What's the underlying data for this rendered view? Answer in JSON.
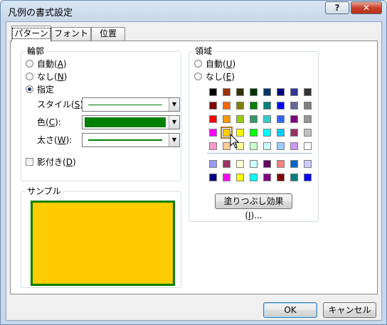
{
  "window": {
    "title": "凡例の書式設定",
    "help_icon": "question-mark",
    "close_icon": "x-mark"
  },
  "tabs": [
    {
      "label": "パターン",
      "active": true
    },
    {
      "label": "フォント",
      "active": false
    },
    {
      "label": "位置",
      "active": false
    }
  ],
  "border": {
    "label": "輪郭",
    "auto": {
      "text": "自動(",
      "key": "A",
      "end": ")"
    },
    "none": {
      "text": "なし(",
      "key": "N",
      "end": ")"
    },
    "custom": {
      "text": "指定"
    },
    "selected": "custom",
    "style": {
      "text": "スタイル(",
      "key": "S",
      "end": "):",
      "line_color": "#008000"
    },
    "color": {
      "text": "色(",
      "key": "C",
      "end": "):",
      "value": "#008000"
    },
    "weight": {
      "text": "太さ(",
      "key": "W",
      "end": "):",
      "line_color": "#008000"
    },
    "shadow": {
      "text": "影付き(",
      "key": "D",
      "end": ")",
      "checked": false
    }
  },
  "area": {
    "label": "領域",
    "auto": {
      "text": "自動(",
      "key": "U",
      "end": ")"
    },
    "none": {
      "text": "なし(",
      "key": "E",
      "end": ")"
    },
    "selected_color": "#ffcc00",
    "palette_main": [
      [
        "#000000",
        "#993300",
        "#333300",
        "#003300",
        "#003366",
        "#000080",
        "#333399",
        "#333333"
      ],
      [
        "#800000",
        "#ff6600",
        "#808000",
        "#008000",
        "#008080",
        "#0000ff",
        "#666699",
        "#808080"
      ],
      [
        "#ff0000",
        "#ff9900",
        "#99cc00",
        "#339966",
        "#33cccc",
        "#3366ff",
        "#800080",
        "#969696"
      ],
      [
        "#ff00ff",
        "#ffcc00",
        "#ffff00",
        "#00ff00",
        "#00ffff",
        "#00ccff",
        "#993366",
        "#c0c0c0"
      ],
      [
        "#ff99cc",
        "#ffcc99",
        "#ffff99",
        "#ccffcc",
        "#ccffff",
        "#99ccff",
        "#cc99ff",
        "#ffffff"
      ]
    ],
    "palette_extra": [
      [
        "#9999ff",
        "#993366",
        "#ffffcc",
        "#ccffff",
        "#660066",
        "#ff8080",
        "#0066cc",
        "#ccccff"
      ],
      [
        "#000080",
        "#ff00ff",
        "#ffff00",
        "#00ffff",
        "#800080",
        "#800000",
        "#008080",
        "#0000ff"
      ]
    ],
    "fill_effects": {
      "text": "塗りつぶし効果(",
      "key": "I",
      "end": ")..."
    }
  },
  "sample": {
    "label": "サンプル",
    "fill": "#ffcc00",
    "border": "#008000"
  },
  "buttons": {
    "ok": "OK",
    "cancel": "キャンセル"
  }
}
